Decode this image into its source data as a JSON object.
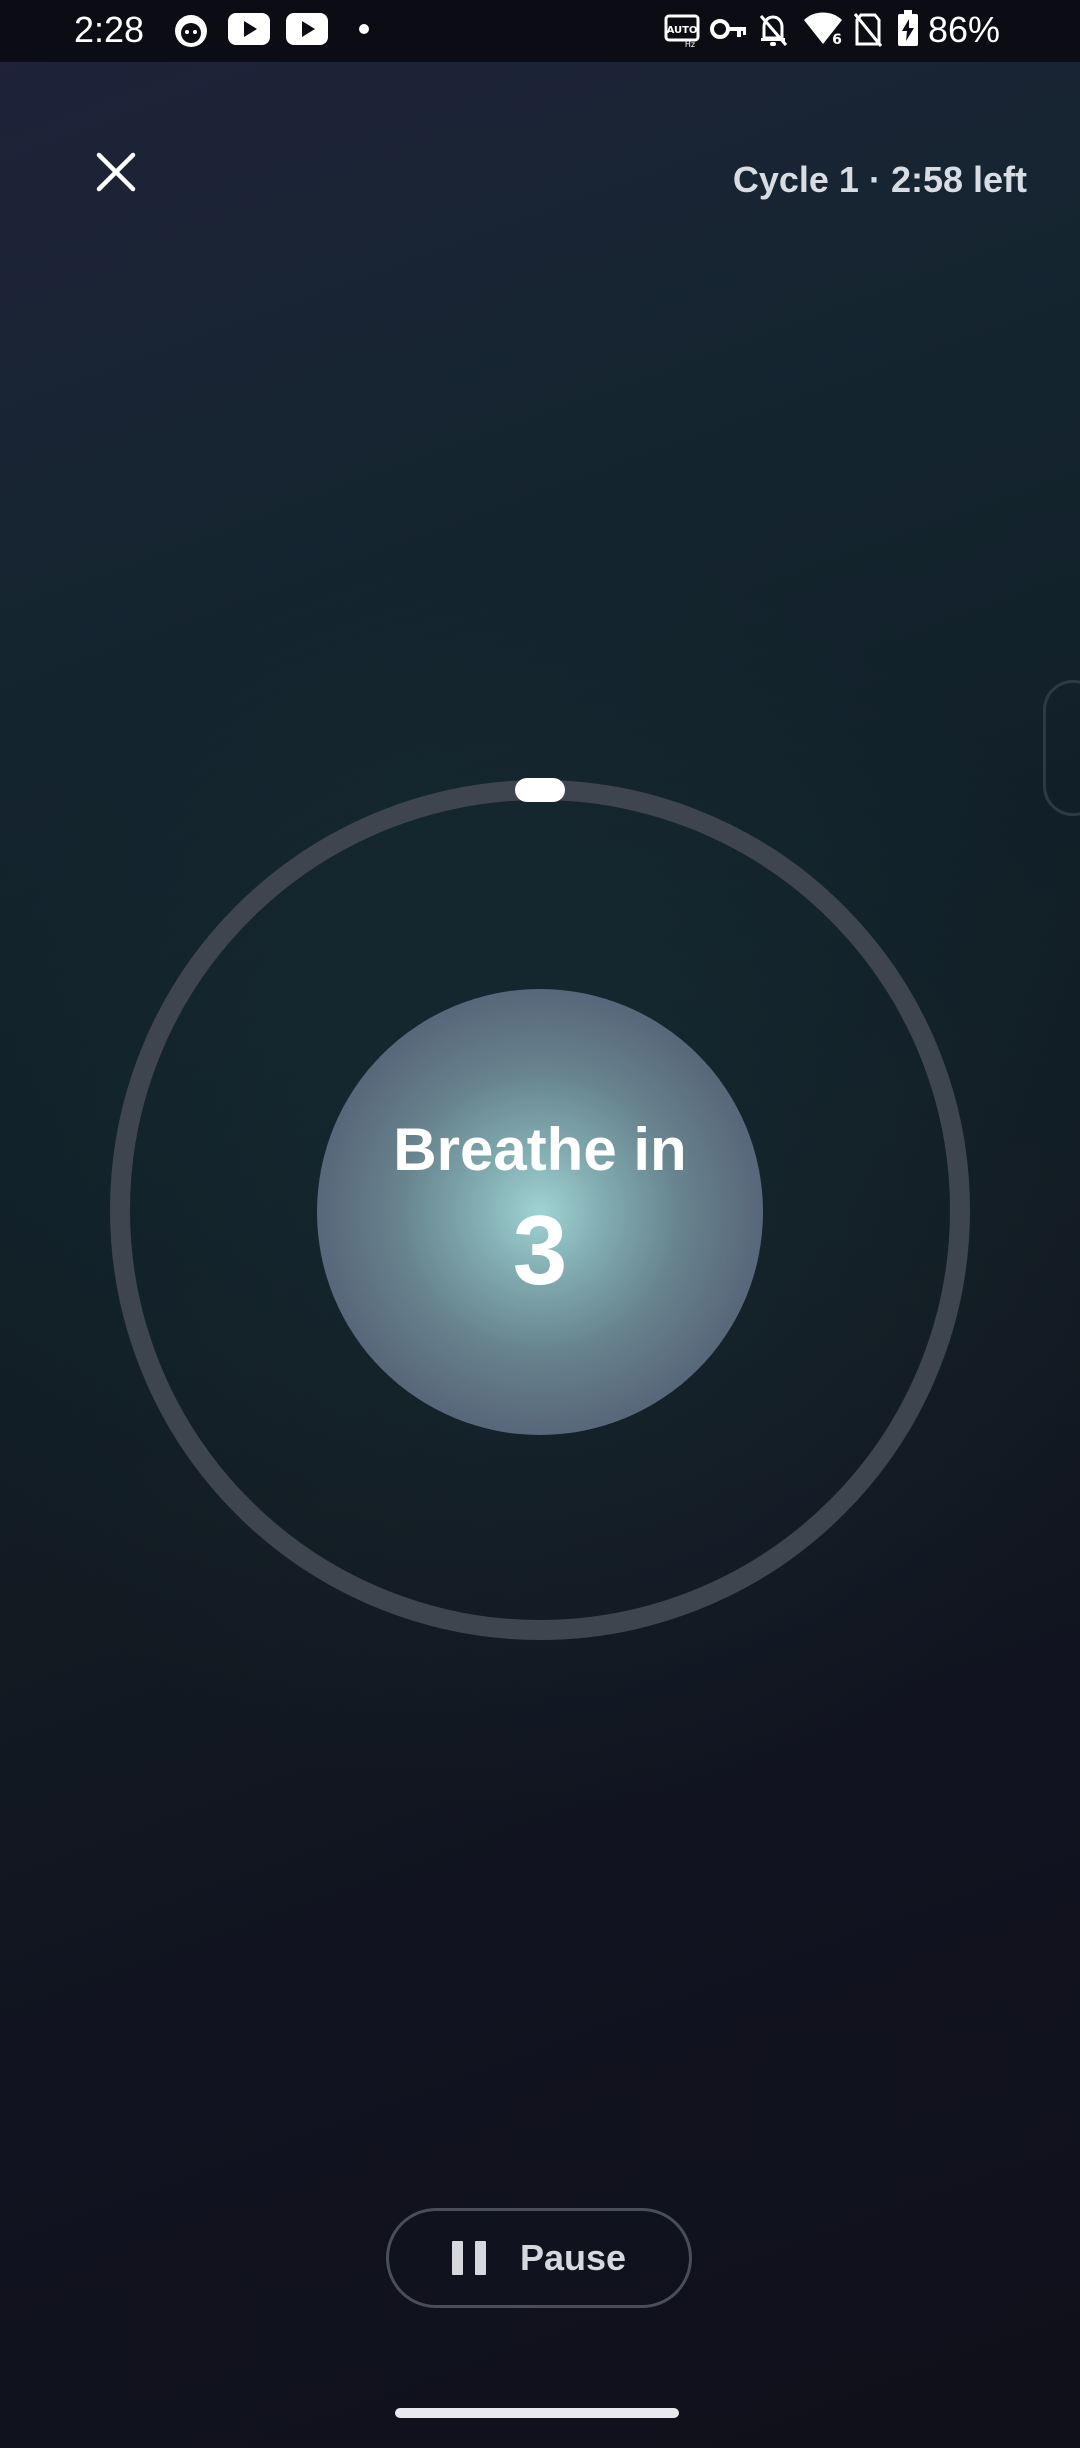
{
  "status_bar": {
    "time": "2:28",
    "battery": "86%",
    "left_icons": [
      "cat-face-icon",
      "youtube-icon",
      "youtube-icon",
      "notification-dot-icon"
    ],
    "right_icons": [
      "auto-hz-icon",
      "vpn-key-icon",
      "bell-off-icon",
      "wifi-6-icon",
      "no-sim-icon",
      "battery-charging-icon"
    ]
  },
  "header": {
    "cycle_status": "Cycle 1 · 2:58 left"
  },
  "breath": {
    "phase": "Breathe in",
    "count": "3",
    "progress": 0.0
  },
  "controls": {
    "pause_label": "Pause"
  },
  "colors": {
    "ring": "#3e454e",
    "orb_center": "#9fd3d3",
    "orb_edge": "#575d72",
    "background_dark": "#10101a",
    "text": "#ffffff"
  }
}
